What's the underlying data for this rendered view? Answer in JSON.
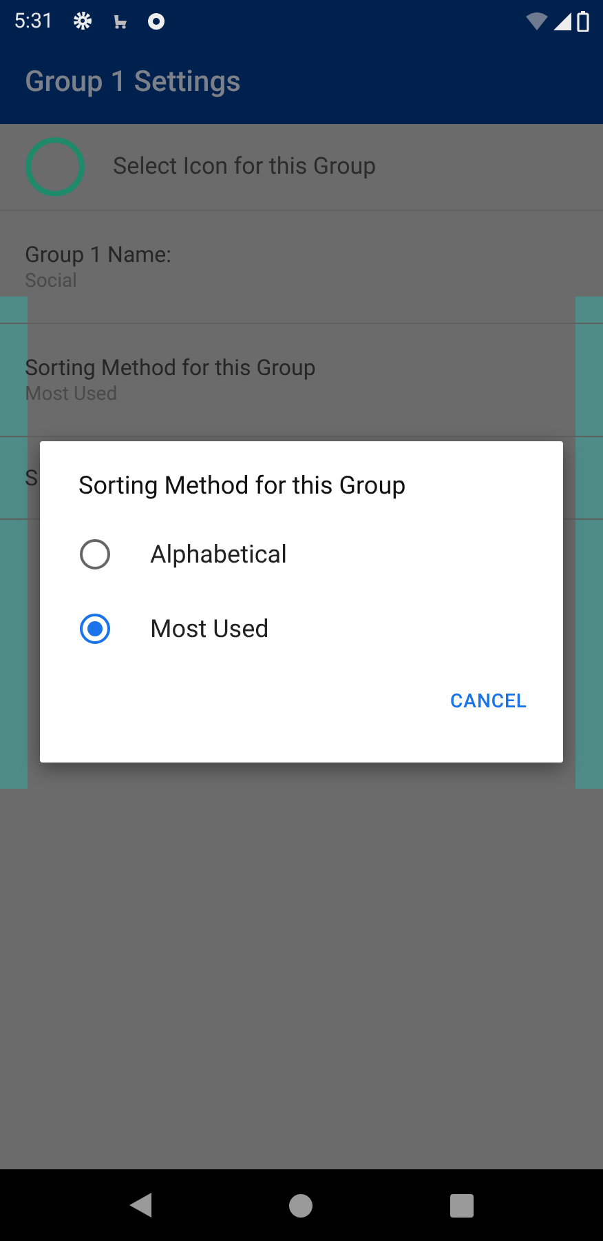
{
  "status_bar": {
    "time": "5:31"
  },
  "app_bar": {
    "title": "Group 1 Settings"
  },
  "icon_row": {
    "label": "Select Icon for this Group"
  },
  "settings": [
    {
      "title": "Group 1 Name:",
      "value": "Social"
    },
    {
      "title": "Sorting Method for this Group",
      "value": "Most Used"
    },
    {
      "title": "S"
    }
  ],
  "dialog": {
    "title": "Sorting Method for this Group",
    "options": [
      {
        "label": "Alphabetical",
        "selected": false
      },
      {
        "label": "Most Used",
        "selected": true
      }
    ],
    "buttons": [
      "CANCEL"
    ]
  }
}
